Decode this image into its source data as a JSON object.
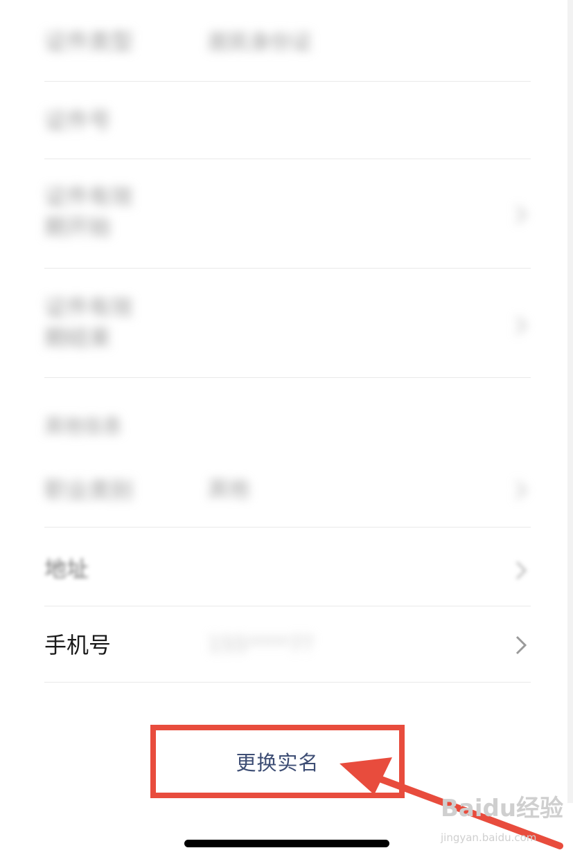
{
  "rows": {
    "id_type": {
      "label": "证件类型",
      "value": "居民身份证"
    },
    "id_number": {
      "label": "证件号",
      "value": ""
    },
    "valid_start": {
      "label": "证件有效\n期开始",
      "value": ""
    },
    "valid_end": {
      "label": "证件有效\n期结束",
      "value": ""
    },
    "other_section": "其他信息",
    "occupation": {
      "label": "职业类别",
      "value": "其他"
    },
    "address": {
      "label": "地址",
      "value": ""
    },
    "phone": {
      "label": "手机号",
      "value": "155****7?"
    }
  },
  "actions": {
    "change_real_name": "更换实名"
  },
  "watermark": {
    "brand": "Baidu经验",
    "url": "jingyan.baidu.com"
  },
  "colors": {
    "highlight": "#e84c3d",
    "button_text": "#3d4d74"
  }
}
